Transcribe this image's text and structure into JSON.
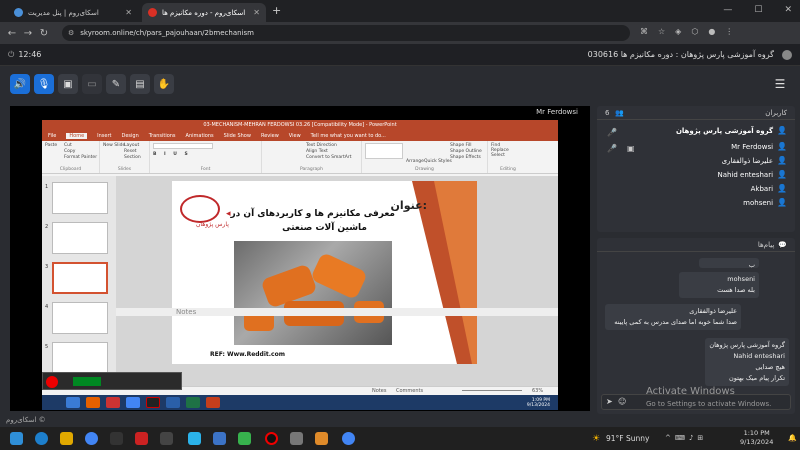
{
  "browser": {
    "tabs": [
      {
        "label": "اسکای‌روم | پنل مدیریت",
        "color": "#4a90d9"
      },
      {
        "label": "اسکای‌روم - دوره مکانیزم ها",
        "color": "#d93025"
      }
    ],
    "url": "skyroom.online/ch/pars_pajouhaan/2bmechanism",
    "new_tab": "+",
    "back": "←",
    "forward": "→",
    "reload": "↻"
  },
  "header": {
    "time": "12:46",
    "room_title": "گروه آموزشی پارس پژوهان : دوره مکانیزم ها 030616"
  },
  "share": {
    "presenter": "Mr Ferdowsi"
  },
  "ppt": {
    "title": "03-MECHANISM-MEHRAN FERDOWSI 03.26 [Compatibility Mode] - PowerPoint",
    "tabs": [
      "File",
      "Home",
      "Insert",
      "Design",
      "Transitions",
      "Animations",
      "Slide Show",
      "Review",
      "View",
      "Tell me what you want to do..."
    ],
    "groups": [
      "Clipboard",
      "Slides",
      "Font",
      "Paragraph",
      "Drawing",
      "Editing"
    ],
    "clipboard": [
      "Paste",
      "Cut",
      "Copy",
      "Format Painter"
    ],
    "slides_grp": [
      "New Slide",
      "Layout",
      "Reset",
      "Section"
    ],
    "paragraph": [
      "Text Direction",
      "Align Text",
      "Convert to SmartArt"
    ],
    "drawing": [
      "Arrange",
      "Quick Styles",
      "Shape Fill",
      "Shape Outline",
      "Shape Effects"
    ],
    "editing": [
      "Find",
      "Replace",
      "Select"
    ],
    "thumbs": [
      "1",
      "2",
      "3",
      "4",
      "5"
    ],
    "slide": {
      "heading": "عنوان:",
      "title_line1": "معرفی مکانیزم ها و کاربردهای آن در",
      "title_line2": "ماشین آلات صنعتی",
      "logo": "پارس پژوهان",
      "ref": "REF: Www.Reddit.com"
    },
    "notes": "Notes",
    "notes_btn": "Notes",
    "comments_btn": "Comments",
    "zoom": "63%",
    "clock": "1:09 PM",
    "date": "9/13/2024"
  },
  "users": {
    "count": "6",
    "title": "کاربران",
    "list": [
      "گروه آموزشی پارس پژوهان",
      "Mr Ferdowsi",
      "علیرضا ذوالفقاری",
      "Nahid enteshari",
      "Akbari",
      "mohseni"
    ]
  },
  "chat": {
    "title": "پیام‌ها",
    "messages": [
      {
        "name": "ب",
        "text": ""
      },
      {
        "name": "mohseni",
        "text": "بله صدا هست"
      },
      {
        "name": "علیرضا ذوالفقاری",
        "text": "صدا شما خوبه اما صدای مدرس به کمی پایینه"
      },
      {
        "name": "گروه آموزشی پارس پژوهان",
        "text": "Nahid enteshari"
      },
      {
        "name": "",
        "text": "هیچ صدایی"
      },
      {
        "name": "",
        "text": "تکرار پیام میک بهتون"
      }
    ]
  },
  "footer": {
    "brand": "اسکای‌روم ©"
  },
  "watermark": {
    "line1": "Activate Windows",
    "line2": "Go to Settings to activate Windows."
  },
  "taskbar": {
    "weather": "91°F Sunny",
    "time": "1:10 PM",
    "date": "9/13/2024"
  }
}
